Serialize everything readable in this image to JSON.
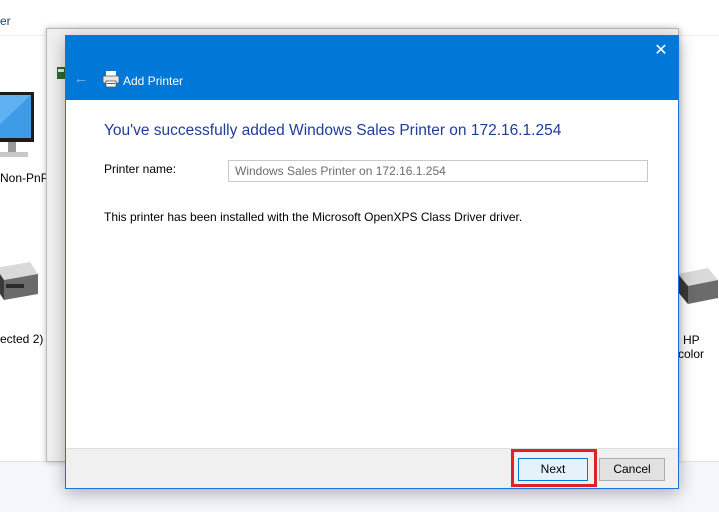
{
  "background": {
    "topbar_fragment": "er",
    "devices": [
      {
        "label": "Non-PnP"
      },
      {
        "label": "ected 2)"
      },
      {
        "label": "HP"
      },
      {
        "label": "color"
      }
    ]
  },
  "dialog": {
    "title": "Add Printer",
    "close_symbol": "✕",
    "back_symbol": "←",
    "heading": "You've successfully added Windows Sales Printer on 172.16.1.254",
    "printer_name_label": "Printer name:",
    "printer_name_value": "Windows Sales Printer on 172.16.1.254",
    "info": "This printer has been installed with the Microsoft OpenXPS Class Driver driver.",
    "buttons": {
      "next": "Next",
      "cancel": "Cancel"
    }
  },
  "colors": {
    "titlebar": "#0078d7",
    "heading": "#1f3d99",
    "highlight": "#e0202a"
  }
}
